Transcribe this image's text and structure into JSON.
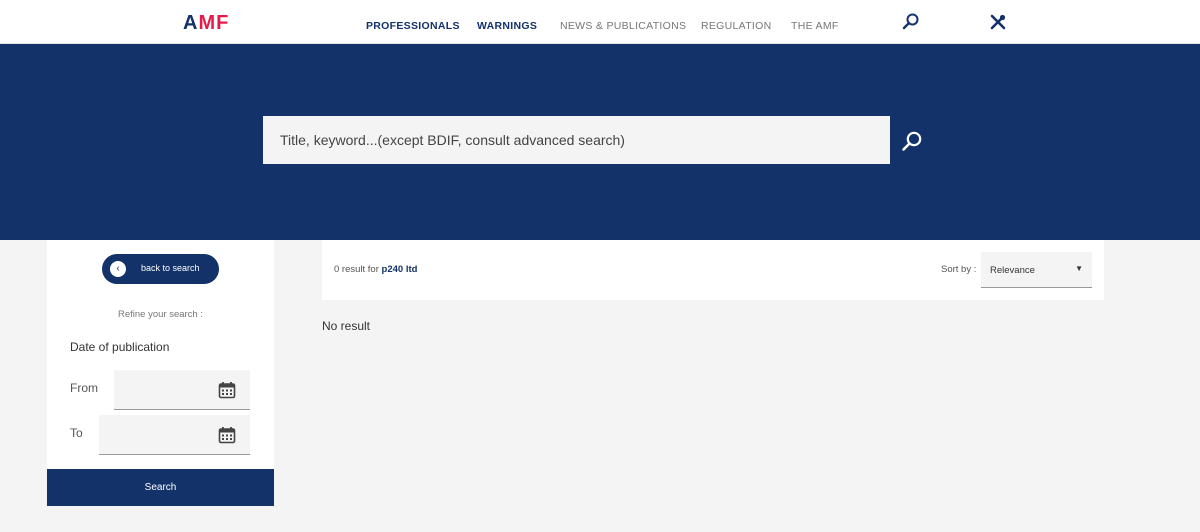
{
  "header": {
    "logo_part1": "A",
    "logo_part2": "M",
    "logo_part3": "F",
    "nav": [
      {
        "label": "PROFESSIONALS",
        "style": "strong"
      },
      {
        "label": "WARNINGS",
        "style": "strong"
      },
      {
        "label": "NEWS & PUBLICATIONS",
        "style": "light"
      },
      {
        "label": "REGULATION",
        "style": "light"
      },
      {
        "label": "THE AMF",
        "style": "light"
      }
    ],
    "icons": [
      "search-icon",
      "tools-icon"
    ]
  },
  "hero": {
    "search_placeholder": "Title, keyword...(except BDIF, consult advanced search)"
  },
  "sidebar": {
    "back_label": "back to search",
    "refine_label": "Refine your search :",
    "date_label": "Date of publication",
    "from_label": "From",
    "to_label": "To",
    "search_button": "Search"
  },
  "results": {
    "count_text": "0 result for",
    "query": "p240 ltd",
    "sort_label": "Sort by :",
    "sort_value": "Relevance",
    "no_result": "No result"
  },
  "colors": {
    "brand_navy": "#13326a",
    "brand_red": "#e41c4b",
    "background": "#f4f4f4"
  }
}
